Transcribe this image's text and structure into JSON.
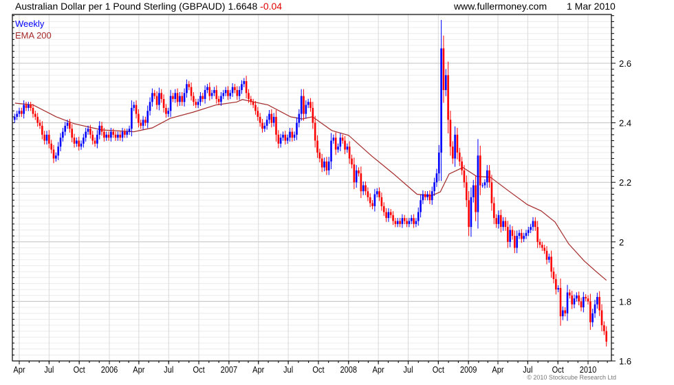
{
  "header": {
    "title": "Australian Dollar per 1 Pound Sterling (GBPAUD)",
    "last_price": "1.6648",
    "change": "-0.04",
    "website": "www.fullermoney.com",
    "date": "1 Mar 2010"
  },
  "legend": {
    "period": "Weekly",
    "indicator": "EMA 200"
  },
  "copyright": "© 2010 Stockcube Research Ltd",
  "colors": {
    "up_candle": "#0000ff",
    "down_candle": "#ff0000",
    "ema": "#a52a2a",
    "change_negative": "#e00000"
  },
  "chart_data": {
    "type": "candlestick",
    "interval": "weekly",
    "first_week": "2005-03-18",
    "ylim": [
      1.6,
      2.764
    ],
    "y_ticks": [
      "1.6",
      "1.8",
      "2",
      "2.2",
      "2.4",
      "2.6"
    ],
    "y_axis_side": "right",
    "grid": true,
    "x_ticks": [
      {
        "label": "Apr",
        "date": "2005-04-01"
      },
      {
        "label": "Jul",
        "date": "2005-07-01"
      },
      {
        "label": "Oct",
        "date": "2005-10-01"
      },
      {
        "label": "2006",
        "date": "2006-01-01"
      },
      {
        "label": "Apr",
        "date": "2006-04-01"
      },
      {
        "label": "Jul",
        "date": "2006-07-01"
      },
      {
        "label": "Oct",
        "date": "2006-10-01"
      },
      {
        "label": "2007",
        "date": "2007-01-01"
      },
      {
        "label": "Apr",
        "date": "2007-04-01"
      },
      {
        "label": "Jul",
        "date": "2007-07-01"
      },
      {
        "label": "Oct",
        "date": "2007-10-01"
      },
      {
        "label": "2008",
        "date": "2008-01-01"
      },
      {
        "label": "Apr",
        "date": "2008-04-01"
      },
      {
        "label": "Jul",
        "date": "2008-07-01"
      },
      {
        "label": "Oct",
        "date": "2008-10-01"
      },
      {
        "label": "2009",
        "date": "2009-01-01"
      },
      {
        "label": "Apr",
        "date": "2009-04-01"
      },
      {
        "label": "Jul",
        "date": "2009-07-01"
      },
      {
        "label": "Oct",
        "date": "2009-10-01"
      },
      {
        "label": "2010",
        "date": "2010-01-01"
      }
    ],
    "weekly_close": [
      2.42,
      2.43,
      2.44,
      2.43,
      2.46,
      2.45,
      2.46,
      2.45,
      2.43,
      2.42,
      2.4,
      2.39,
      2.36,
      2.34,
      2.36,
      2.33,
      2.31,
      2.28,
      2.29,
      2.32,
      2.35,
      2.37,
      2.39,
      2.4,
      2.38,
      2.35,
      2.33,
      2.34,
      2.32,
      2.33,
      2.35,
      2.37,
      2.38,
      2.36,
      2.34,
      2.33,
      2.36,
      2.39,
      2.37,
      2.35,
      2.36,
      2.35,
      2.37,
      2.36,
      2.35,
      2.36,
      2.35,
      2.37,
      2.36,
      2.37,
      2.38,
      2.45,
      2.46,
      2.43,
      2.4,
      2.39,
      2.41,
      2.4,
      2.44,
      2.47,
      2.5,
      2.49,
      2.46,
      2.5,
      2.48,
      2.45,
      2.43,
      2.44,
      2.49,
      2.48,
      2.5,
      2.47,
      2.49,
      2.47,
      2.5,
      2.53,
      2.52,
      2.49,
      2.47,
      2.46,
      2.47,
      2.49,
      2.48,
      2.51,
      2.52,
      2.49,
      2.5,
      2.51,
      2.48,
      2.47,
      2.49,
      2.5,
      2.51,
      2.49,
      2.5,
      2.52,
      2.51,
      2.49,
      2.51,
      2.53,
      2.54,
      2.5,
      2.48,
      2.47,
      2.46,
      2.44,
      2.42,
      2.4,
      2.38,
      2.39,
      2.41,
      2.43,
      2.4,
      2.42,
      2.36,
      2.33,
      2.35,
      2.36,
      2.34,
      2.35,
      2.37,
      2.35,
      2.36,
      2.4,
      2.43,
      2.49,
      2.43,
      2.46,
      2.47,
      2.45,
      2.4,
      2.34,
      2.3,
      2.28,
      2.25,
      2.27,
      2.24,
      2.27,
      2.34,
      2.35,
      2.31,
      2.32,
      2.35,
      2.34,
      2.31,
      2.32,
      2.28,
      2.26,
      2.2,
      2.24,
      2.23,
      2.17,
      2.19,
      2.17,
      2.15,
      2.13,
      2.12,
      2.16,
      2.17,
      2.15,
      2.12,
      2.1,
      2.08,
      2.1,
      2.09,
      2.07,
      2.06,
      2.07,
      2.06,
      2.08,
      2.07,
      2.06,
      2.07,
      2.08,
      2.06,
      2.07,
      2.1,
      2.14,
      2.16,
      2.15,
      2.16,
      2.14,
      2.17,
      2.2,
      2.23,
      2.3,
      2.65,
      2.51,
      2.56,
      2.41,
      2.32,
      2.28,
      2.36,
      2.3,
      2.27,
      2.24,
      2.2,
      2.14,
      2.05,
      2.15,
      2.19,
      2.1,
      2.29,
      2.19,
      2.19,
      2.2,
      2.24,
      2.2,
      2.13,
      2.08,
      2.06,
      2.09,
      2.05,
      2.07,
      2.05,
      2.0,
      2.04,
      2.02,
      1.98,
      2.02,
      2.03,
      2.01,
      2.02,
      2.03,
      2.04,
      2.05,
      2.07,
      2.05,
      2.0,
      1.99,
      1.98,
      1.97,
      1.94,
      1.95,
      1.9,
      1.875,
      1.84,
      1.845,
      1.75,
      1.77,
      1.76,
      1.83,
      1.82,
      1.79,
      1.81,
      1.82,
      1.8,
      1.78,
      1.815,
      1.81,
      1.8,
      1.73,
      1.76,
      1.79,
      1.815,
      1.77,
      1.72,
      1.7,
      1.665
    ],
    "ema_200": [
      [
        "2005-03-19",
        2.466
      ],
      [
        "2005-05-13",
        2.46
      ],
      [
        "2005-07-23",
        2.42
      ],
      [
        "2005-09-16",
        2.397
      ],
      [
        "2005-12-09",
        2.376
      ],
      [
        "2006-03-17",
        2.37
      ],
      [
        "2006-05-12",
        2.383
      ],
      [
        "2006-07-06",
        2.415
      ],
      [
        "2006-09-15",
        2.436
      ],
      [
        "2006-11-23",
        2.46
      ],
      [
        "2007-01-25",
        2.47
      ],
      [
        "2007-02-11",
        2.478
      ],
      [
        "2007-04-30",
        2.46
      ],
      [
        "2007-07-08",
        2.42
      ],
      [
        "2007-08-13",
        2.413
      ],
      [
        "2007-09-13",
        2.42
      ],
      [
        "2007-11-11",
        2.374
      ],
      [
        "2008-01-01",
        2.358
      ],
      [
        "2008-03-10",
        2.29
      ],
      [
        "2008-05-18",
        2.228
      ],
      [
        "2008-07-28",
        2.16
      ],
      [
        "2008-09-10",
        2.155
      ],
      [
        "2008-10-07",
        2.168
      ],
      [
        "2008-11-03",
        2.228
      ],
      [
        "2008-12-15",
        2.25
      ],
      [
        "2009-01-26",
        2.22
      ],
      [
        "2009-03-09",
        2.217
      ],
      [
        "2009-05-05",
        2.17
      ],
      [
        "2009-06-30",
        2.125
      ],
      [
        "2009-08-11",
        2.104
      ],
      [
        "2009-09-22",
        2.067
      ],
      [
        "2009-11-03",
        1.993
      ],
      [
        "2009-12-21",
        1.935
      ],
      [
        "2010-01-26",
        1.9
      ],
      [
        "2010-02-26",
        1.871
      ]
    ]
  }
}
